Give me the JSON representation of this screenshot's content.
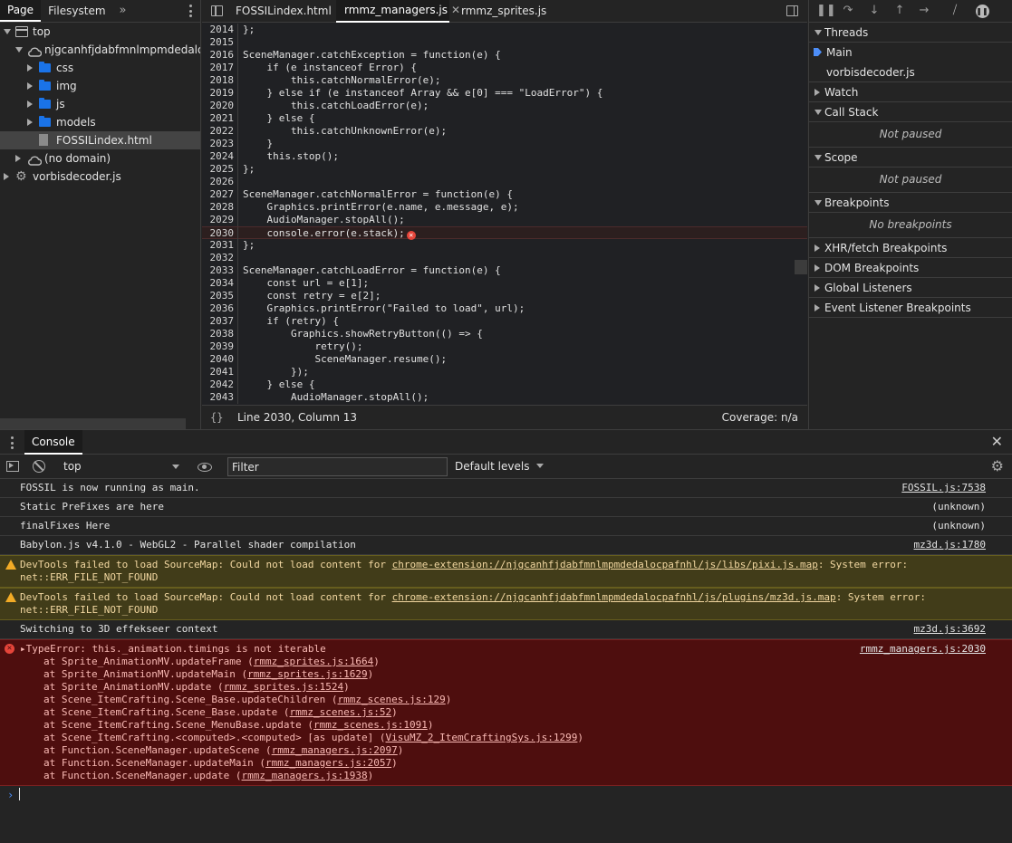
{
  "navigator": {
    "tabs": [
      "Page",
      "Filesystem"
    ],
    "more_tabs": "»",
    "tree": [
      {
        "label": "top",
        "kind": "frame",
        "indent": 0,
        "expanded": true
      },
      {
        "label": "njgcanhfjdabfmnlmpmdedalocpafnhl",
        "kind": "cloud",
        "indent": 1,
        "expanded": true
      },
      {
        "label": "css",
        "kind": "folder",
        "indent": 2,
        "expanded": false
      },
      {
        "label": "img",
        "kind": "folder",
        "indent": 2,
        "expanded": false
      },
      {
        "label": "js",
        "kind": "folder",
        "indent": 2,
        "expanded": false
      },
      {
        "label": "models",
        "kind": "folder",
        "indent": 2,
        "expanded": false
      },
      {
        "label": "FOSSILindex.html",
        "kind": "file",
        "indent": 2,
        "selected": true
      },
      {
        "label": "(no domain)",
        "kind": "cloud",
        "indent": 1,
        "expanded": false
      },
      {
        "label": "vorbisdecoder.js",
        "kind": "gear",
        "indent": 0,
        "expanded": false
      }
    ]
  },
  "editor": {
    "tabs": [
      {
        "label": "FOSSILindex.html",
        "active": false
      },
      {
        "label": "rmmz_managers.js",
        "active": true,
        "closable": true
      },
      {
        "label": "rmmz_sprites.js",
        "active": false
      }
    ],
    "lines": [
      {
        "n": "2014",
        "t": "};"
      },
      {
        "n": "2015",
        "t": ""
      },
      {
        "n": "2016",
        "t": "SceneManager.catchException = function(e) {"
      },
      {
        "n": "2017",
        "t": "    if (e instanceof Error) {"
      },
      {
        "n": "2018",
        "t": "        this.catchNormalError(e);"
      },
      {
        "n": "2019",
        "t": "    } else if (e instanceof Array && e[0] === \"LoadError\") {"
      },
      {
        "n": "2020",
        "t": "        this.catchLoadError(e);"
      },
      {
        "n": "2021",
        "t": "    } else {"
      },
      {
        "n": "2022",
        "t": "        this.catchUnknownError(e);"
      },
      {
        "n": "2023",
        "t": "    }"
      },
      {
        "n": "2024",
        "t": "    this.stop();"
      },
      {
        "n": "2025",
        "t": "};"
      },
      {
        "n": "2026",
        "t": ""
      },
      {
        "n": "2027",
        "t": "SceneManager.catchNormalError = function(e) {"
      },
      {
        "n": "2028",
        "t": "    Graphics.printError(e.name, e.message, e);"
      },
      {
        "n": "2029",
        "t": "    AudioManager.stopAll();"
      },
      {
        "n": "2030",
        "t": "    console.error(e.stack);",
        "error": true
      },
      {
        "n": "2031",
        "t": "};"
      },
      {
        "n": "2032",
        "t": ""
      },
      {
        "n": "2033",
        "t": "SceneManager.catchLoadError = function(e) {"
      },
      {
        "n": "2034",
        "t": "    const url = e[1];"
      },
      {
        "n": "2035",
        "t": "    const retry = e[2];"
      },
      {
        "n": "2036",
        "t": "    Graphics.printError(\"Failed to load\", url);"
      },
      {
        "n": "2037",
        "t": "    if (retry) {"
      },
      {
        "n": "2038",
        "t": "        Graphics.showRetryButton(() => {"
      },
      {
        "n": "2039",
        "t": "            retry();"
      },
      {
        "n": "2040",
        "t": "            SceneManager.resume();"
      },
      {
        "n": "2041",
        "t": "        });"
      },
      {
        "n": "2042",
        "t": "    } else {"
      },
      {
        "n": "2043",
        "t": "        AudioManager.stopAll();"
      }
    ],
    "status": {
      "braces": "{}",
      "position": "Line 2030, Column 13",
      "coverage": "Coverage: n/a"
    }
  },
  "debugger": {
    "threads": {
      "title": "Threads",
      "items": [
        "Main",
        "vorbisdecoder.js"
      ]
    },
    "watch": {
      "title": "Watch"
    },
    "call_stack": {
      "title": "Call Stack",
      "empty": "Not paused"
    },
    "scope": {
      "title": "Scope",
      "empty": "Not paused"
    },
    "breakpoints": {
      "title": "Breakpoints",
      "empty": "No breakpoints"
    },
    "collapsed_sections": [
      "XHR/fetch Breakpoints",
      "DOM Breakpoints",
      "Global Listeners",
      "Event Listener Breakpoints"
    ]
  },
  "console": {
    "tab_label": "Console",
    "context": "top",
    "filter_placeholder": "Filter",
    "levels": "Default levels",
    "messages": [
      {
        "type": "log",
        "text": "FOSSIL is now running as main.",
        "source": "FOSSIL.js:7538",
        "link": true
      },
      {
        "type": "log",
        "text": "Static PreFixes are here",
        "source": "(unknown)",
        "link": false
      },
      {
        "type": "log",
        "text": "finalFixes Here",
        "source": "(unknown)",
        "link": false
      },
      {
        "type": "log",
        "text": "Babylon.js v4.1.0 - WebGL2 - Parallel shader compilation",
        "source": "mz3d.js:1780",
        "link": true
      },
      {
        "type": "warn",
        "pre": "DevTools failed to load SourceMap: Could not load content for ",
        "url": "chrome-extension://njgcanhfjdabfmnlmpmdedalocpafnhl/js/libs/pixi.js.map",
        "post": ": System error:",
        "line2": "net::ERR_FILE_NOT_FOUND"
      },
      {
        "type": "warn",
        "pre": "DevTools failed to load SourceMap: Could not load content for ",
        "url": "chrome-extension://njgcanhfjdabfmnlmpmdedalocpafnhl/js/plugins/mz3d.js.map",
        "post": ": System error:",
        "line2": "net::ERR_FILE_NOT_FOUND"
      },
      {
        "type": "log",
        "text": "Switching to 3D effekseer context",
        "source": "mz3d.js:3692",
        "link": true
      }
    ],
    "error": {
      "head": "▸TypeError: this._animation.timings is not iterable",
      "source": "rmmz_managers.js:2030",
      "stack": [
        {
          "pre": "at Sprite_AnimationMV.updateFrame (",
          "loc": "rmmz_sprites.js:1664",
          "post": ")"
        },
        {
          "pre": "at Sprite_AnimationMV.updateMain (",
          "loc": "rmmz_sprites.js:1629",
          "post": ")"
        },
        {
          "pre": "at Sprite_AnimationMV.update (",
          "loc": "rmmz_sprites.js:1524",
          "post": ")"
        },
        {
          "pre": "at Scene_ItemCrafting.Scene_Base.updateChildren (",
          "loc": "rmmz_scenes.js:129",
          "post": ")"
        },
        {
          "pre": "at Scene_ItemCrafting.Scene_Base.update (",
          "loc": "rmmz_scenes.js:52",
          "post": ")"
        },
        {
          "pre": "at Scene_ItemCrafting.Scene_MenuBase.update (",
          "loc": "rmmz_scenes.js:1091",
          "post": ")"
        },
        {
          "pre": "at Scene_ItemCrafting.<computed>.<computed> [as update] (",
          "loc": "VisuMZ_2_ItemCraftingSys.js:1299",
          "post": ")"
        },
        {
          "pre": "at Function.SceneManager.updateScene (",
          "loc": "rmmz_managers.js:2097",
          "post": ")"
        },
        {
          "pre": "at Function.SceneManager.updateMain (",
          "loc": "rmmz_managers.js:2057",
          "post": ")"
        },
        {
          "pre": "at Function.SceneManager.update (",
          "loc": "rmmz_managers.js:1938",
          "post": ")"
        }
      ]
    },
    "prompt": "›"
  },
  "colors": {
    "accent": "#4d8ef7",
    "error_bg": "#4e0e0e",
    "warning_bg": "#413c19",
    "folder": "#1a73e8"
  }
}
